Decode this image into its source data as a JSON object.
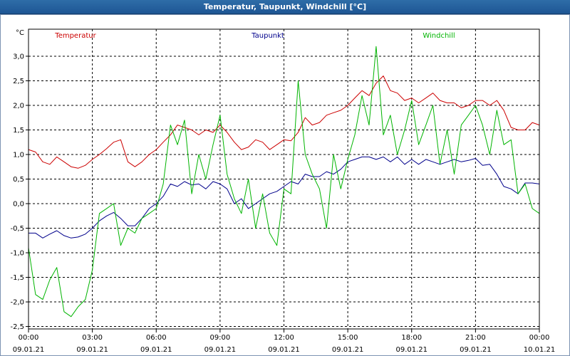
{
  "window": {
    "title": "Temperatur, Taupunkt, Windchill [°C]"
  },
  "chart_data": {
    "type": "line",
    "title": "Temperatur, Taupunkt, Windchill [°C]",
    "ylabel": "°C",
    "ylim": [
      -2.55,
      3.55
    ],
    "xlim": [
      0,
      24
    ],
    "grid": true,
    "legend_placement": "top",
    "y_ticks": [
      "3,0",
      "2,5",
      "2,0",
      "1,5",
      "1,0",
      "0,5",
      "0,0",
      "-0,5",
      "-1,0",
      "-1,5",
      "-2,0",
      "-2,5"
    ],
    "y_tick_values": [
      3.0,
      2.5,
      2.0,
      1.5,
      1.0,
      0.5,
      0.0,
      -0.5,
      -1.0,
      -1.5,
      -2.0,
      -2.5
    ],
    "x_ticks": [
      {
        "time": "00:00",
        "date": "09.01.21",
        "hour": 0
      },
      {
        "time": "03:00",
        "date": "09.01.21",
        "hour": 3
      },
      {
        "time": "06:00",
        "date": "09.01.21",
        "hour": 6
      },
      {
        "time": "09:00",
        "date": "09.01.21",
        "hour": 9
      },
      {
        "time": "12:00",
        "date": "09.01.21",
        "hour": 12
      },
      {
        "time": "15:00",
        "date": "09.01.21",
        "hour": 15
      },
      {
        "time": "18:00",
        "date": "09.01.21",
        "hour": 18
      },
      {
        "time": "21:00",
        "date": "09.01.21",
        "hour": 21
      },
      {
        "time": "00:00",
        "date": "10.01.21",
        "hour": 24
      }
    ],
    "series": [
      {
        "name": "Temperatur",
        "color": "#cc0000",
        "x": [
          0,
          0.33,
          0.67,
          1,
          1.33,
          1.67,
          2,
          2.33,
          2.67,
          3,
          3.33,
          3.67,
          4,
          4.33,
          4.67,
          5,
          5.33,
          5.67,
          6,
          6.33,
          6.67,
          7,
          7.33,
          7.67,
          8,
          8.33,
          8.67,
          9,
          9.33,
          9.67,
          10,
          10.33,
          10.67,
          11,
          11.33,
          11.67,
          12,
          12.33,
          12.67,
          13,
          13.33,
          13.67,
          14,
          14.33,
          14.67,
          15,
          15.33,
          15.67,
          16,
          16.33,
          16.67,
          17,
          17.33,
          17.67,
          18,
          18.33,
          18.67,
          19,
          19.33,
          19.67,
          20,
          20.33,
          20.67,
          21,
          21.33,
          21.67,
          22,
          22.33,
          22.67,
          23,
          23.33,
          23.67,
          24
        ],
        "values": [
          1.1,
          1.05,
          0.85,
          0.8,
          0.95,
          0.85,
          0.75,
          0.72,
          0.78,
          0.9,
          1.0,
          1.12,
          1.25,
          1.3,
          0.85,
          0.75,
          0.85,
          1.0,
          1.1,
          1.25,
          1.4,
          1.6,
          1.55,
          1.5,
          1.4,
          1.5,
          1.45,
          1.6,
          1.45,
          1.25,
          1.1,
          1.15,
          1.3,
          1.25,
          1.1,
          1.2,
          1.3,
          1.28,
          1.45,
          1.75,
          1.6,
          1.65,
          1.8,
          1.85,
          1.9,
          2.0,
          2.15,
          2.3,
          2.2,
          2.45,
          2.6,
          2.3,
          2.25,
          2.1,
          2.15,
          2.05,
          2.15,
          2.25,
          2.1,
          2.05,
          2.05,
          1.95,
          2.0,
          2.1,
          2.1,
          2.0,
          2.1,
          1.9,
          1.55,
          1.5,
          1.5,
          1.65,
          1.6
        ]
      },
      {
        "name": "Taupunkt",
        "color": "#00008b",
        "x": [
          0,
          0.33,
          0.67,
          1,
          1.33,
          1.67,
          2,
          2.33,
          2.67,
          3,
          3.33,
          3.67,
          4,
          4.33,
          4.67,
          5,
          5.33,
          5.67,
          6,
          6.33,
          6.67,
          7,
          7.33,
          7.67,
          8,
          8.33,
          8.67,
          9,
          9.33,
          9.67,
          10,
          10.33,
          10.67,
          11,
          11.33,
          11.67,
          12,
          12.33,
          12.67,
          13,
          13.33,
          13.67,
          14,
          14.33,
          14.67,
          15,
          15.33,
          15.67,
          16,
          16.33,
          16.67,
          17,
          17.33,
          17.67,
          18,
          18.33,
          18.67,
          19,
          19.33,
          19.67,
          20,
          20.33,
          20.67,
          21,
          21.33,
          21.67,
          22,
          22.33,
          22.67,
          23,
          23.33,
          23.67,
          24
        ],
        "values": [
          -0.6,
          -0.6,
          -0.7,
          -0.62,
          -0.55,
          -0.65,
          -0.7,
          -0.68,
          -0.62,
          -0.5,
          -0.35,
          -0.25,
          -0.18,
          -0.3,
          -0.45,
          -0.45,
          -0.3,
          -0.1,
          0.0,
          0.15,
          0.4,
          0.35,
          0.45,
          0.38,
          0.4,
          0.3,
          0.45,
          0.4,
          0.3,
          0.0,
          0.1,
          -0.1,
          0.0,
          0.1,
          0.2,
          0.25,
          0.35,
          0.45,
          0.4,
          0.6,
          0.55,
          0.55,
          0.65,
          0.6,
          0.7,
          0.85,
          0.9,
          0.95,
          0.95,
          0.9,
          0.95,
          0.85,
          0.95,
          0.8,
          0.9,
          0.8,
          0.9,
          0.85,
          0.8,
          0.85,
          0.9,
          0.85,
          0.88,
          0.92,
          0.78,
          0.8,
          0.6,
          0.35,
          0.3,
          0.2,
          0.42,
          0.42,
          0.4
        ]
      },
      {
        "name": "Windchill",
        "color": "#00b400",
        "x": [
          0,
          0.33,
          0.67,
          1,
          1.33,
          1.67,
          2,
          2.33,
          2.67,
          3,
          3.33,
          3.67,
          4,
          4.33,
          4.67,
          5,
          5.33,
          5.67,
          6,
          6.33,
          6.67,
          7,
          7.33,
          7.67,
          8,
          8.33,
          8.67,
          9,
          9.33,
          9.67,
          10,
          10.33,
          10.67,
          11,
          11.33,
          11.67,
          12,
          12.33,
          12.67,
          13,
          13.33,
          13.67,
          14,
          14.33,
          14.67,
          15,
          15.33,
          15.67,
          16,
          16.33,
          16.67,
          17,
          17.33,
          17.67,
          18,
          18.33,
          18.67,
          19,
          19.33,
          19.67,
          20,
          20.33,
          20.67,
          21,
          21.33,
          21.67,
          22,
          22.33,
          22.67,
          23,
          23.33,
          23.67,
          24
        ],
        "values": [
          -0.9,
          -1.85,
          -1.95,
          -1.55,
          -1.3,
          -2.2,
          -2.3,
          -2.1,
          -1.95,
          -1.35,
          -0.2,
          -0.1,
          0.0,
          -0.85,
          -0.5,
          -0.6,
          -0.3,
          -0.2,
          -0.1,
          0.4,
          1.6,
          1.2,
          1.7,
          0.2,
          1.0,
          0.5,
          1.2,
          1.8,
          0.6,
          0.1,
          -0.2,
          0.5,
          -0.5,
          0.2,
          -0.6,
          -0.85,
          0.3,
          0.2,
          2.5,
          1.0,
          0.6,
          0.3,
          -0.5,
          1.0,
          0.3,
          0.9,
          1.4,
          2.2,
          1.6,
          3.2,
          1.4,
          1.8,
          1.0,
          1.5,
          2.1,
          1.2,
          1.6,
          2.0,
          0.8,
          1.5,
          0.6,
          1.6,
          1.8,
          2.0,
          1.6,
          1.0,
          1.9,
          1.2,
          1.3,
          0.2,
          0.4,
          -0.1,
          -0.2
        ]
      }
    ]
  }
}
